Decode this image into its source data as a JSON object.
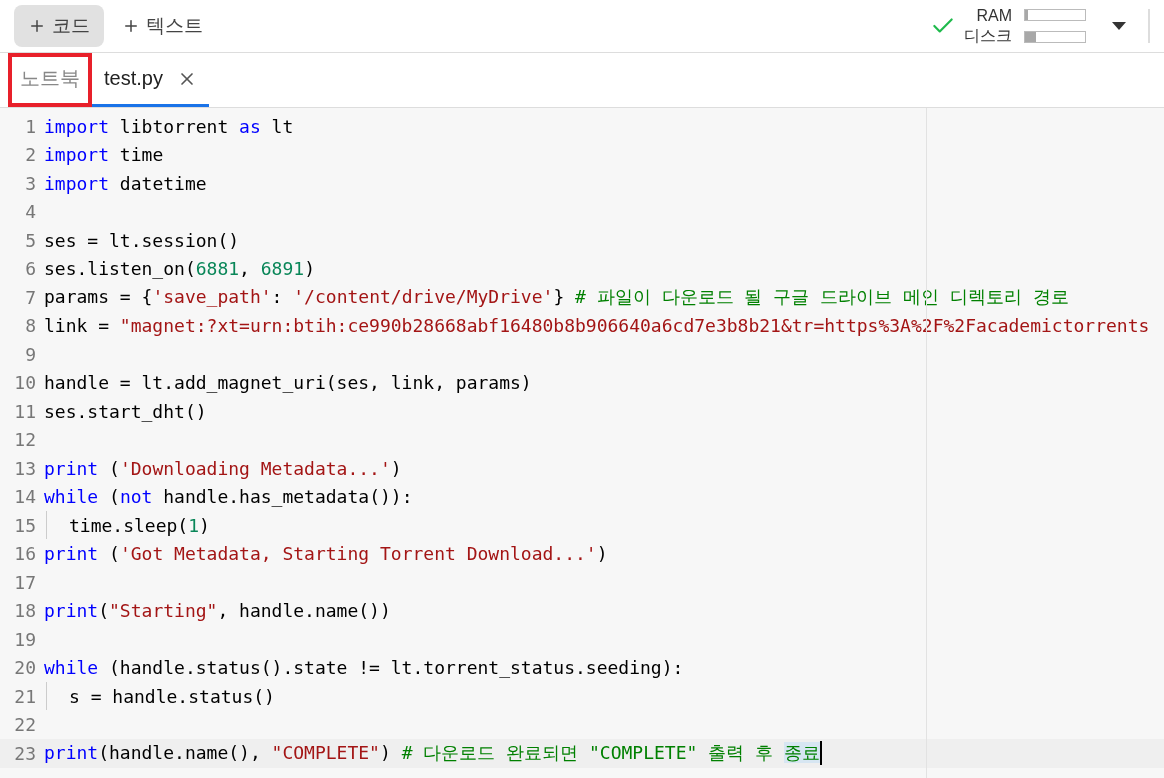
{
  "toolbar": {
    "buttons": [
      {
        "label": "코드",
        "pressed": true
      },
      {
        "label": "텍스트",
        "pressed": false
      }
    ],
    "status": {
      "connected": true
    },
    "meters": [
      {
        "label": "RAM",
        "level": 0.05
      },
      {
        "label": "디스크",
        "level": 0.18
      }
    ]
  },
  "tabs": [
    {
      "label": "노트북",
      "selected": false,
      "closable": false,
      "highlighted": true
    },
    {
      "label": "test.py",
      "selected": true,
      "closable": true,
      "highlighted": false
    }
  ],
  "editor": {
    "lines": [
      {
        "number": "1",
        "tokens": [
          {
            "kind": "kw",
            "text": "import"
          },
          {
            "kind": "plain",
            "text": " libtorrent "
          },
          {
            "kind": "kw",
            "text": "as"
          },
          {
            "kind": "plain",
            "text": " lt"
          }
        ]
      },
      {
        "number": "2",
        "tokens": [
          {
            "kind": "kw",
            "text": "import"
          },
          {
            "kind": "plain",
            "text": " time"
          }
        ]
      },
      {
        "number": "3",
        "tokens": [
          {
            "kind": "kw",
            "text": "import"
          },
          {
            "kind": "plain",
            "text": " datetime"
          }
        ]
      },
      {
        "number": "4"
      },
      {
        "number": "5",
        "tokens": [
          {
            "kind": "plain",
            "text": "ses = lt.session()"
          }
        ]
      },
      {
        "number": "6",
        "tokens": [
          {
            "kind": "plain",
            "text": "ses.listen_on("
          },
          {
            "kind": "num",
            "text": "6881"
          },
          {
            "kind": "plain",
            "text": ", "
          },
          {
            "kind": "num",
            "text": "6891"
          },
          {
            "kind": "plain",
            "text": ")"
          }
        ]
      },
      {
        "number": "7",
        "tokens": [
          {
            "kind": "plain",
            "text": "params = {"
          },
          {
            "kind": "str",
            "text": "'save_path'"
          },
          {
            "kind": "plain",
            "text": ": "
          },
          {
            "kind": "str",
            "text": "'/content/drive/MyDrive'"
          },
          {
            "kind": "plain",
            "text": "} "
          },
          {
            "kind": "cmt",
            "text": "# 파일이 다운로드 될 구글 드라이브 메인 디렉토리 경로"
          }
        ]
      },
      {
        "number": "8",
        "tokens": [
          {
            "kind": "plain",
            "text": "link = "
          },
          {
            "kind": "str",
            "text": "\"magnet:?xt=urn:btih:ce990b28668abf16480b8b906640a6cd7e3b8b21&tr=https%3A%2F%2Facademictorrents"
          }
        ]
      },
      {
        "number": "9"
      },
      {
        "number": "10",
        "tokens": [
          {
            "kind": "plain",
            "text": "handle = lt.add_magnet_uri(ses, link, params)"
          }
        ]
      },
      {
        "number": "11",
        "tokens": [
          {
            "kind": "plain",
            "text": "ses.start_dht()"
          }
        ]
      },
      {
        "number": "12"
      },
      {
        "number": "13",
        "tokens": [
          {
            "kind": "kw",
            "text": "print"
          },
          {
            "kind": "plain",
            "text": " ("
          },
          {
            "kind": "str",
            "text": "'Downloading Metadata...'"
          },
          {
            "kind": "plain",
            "text": ")"
          }
        ]
      },
      {
        "number": "14",
        "tokens": [
          {
            "kind": "kw",
            "text": "while"
          },
          {
            "kind": "plain",
            "text": " ("
          },
          {
            "kind": "kw",
            "text": "not"
          },
          {
            "kind": "plain",
            "text": " handle.has_metadata()):"
          }
        ]
      },
      {
        "number": "15",
        "indented": true,
        "tokens": [
          {
            "kind": "plain",
            "text": "time.sleep("
          },
          {
            "kind": "num",
            "text": "1"
          },
          {
            "kind": "plain",
            "text": ")"
          }
        ]
      },
      {
        "number": "16",
        "tokens": [
          {
            "kind": "kw",
            "text": "print"
          },
          {
            "kind": "plain",
            "text": " ("
          },
          {
            "kind": "str",
            "text": "'Got Metadata, Starting Torrent Download...'"
          },
          {
            "kind": "plain",
            "text": ")"
          }
        ]
      },
      {
        "number": "17"
      },
      {
        "number": "18",
        "tokens": [
          {
            "kind": "kw",
            "text": "print"
          },
          {
            "kind": "plain",
            "text": "("
          },
          {
            "kind": "str",
            "text": "\"Starting\""
          },
          {
            "kind": "plain",
            "text": ", handle.name())"
          }
        ]
      },
      {
        "number": "19"
      },
      {
        "number": "20",
        "tokens": [
          {
            "kind": "kw",
            "text": "while"
          },
          {
            "kind": "plain",
            "text": " (handle.status().state != lt.torrent_status.seeding):"
          }
        ]
      },
      {
        "number": "21",
        "indented": true,
        "tokens": [
          {
            "kind": "plain",
            "text": "s = handle.status()"
          }
        ]
      },
      {
        "number": "22"
      },
      {
        "number": "23",
        "current": true,
        "tokens": [
          {
            "kind": "kw",
            "text": "print"
          },
          {
            "kind": "plain",
            "text": "(handle.name(), "
          },
          {
            "kind": "str",
            "text": "\"COMPLETE\""
          },
          {
            "kind": "plain",
            "text": ") "
          },
          {
            "kind": "cmt",
            "text": "# 다운로드 완료되면 \"COMPLETE\" 출력 후 "
          },
          {
            "kind": "cmt",
            "text": "종료",
            "selected": true
          }
        ]
      }
    ]
  }
}
